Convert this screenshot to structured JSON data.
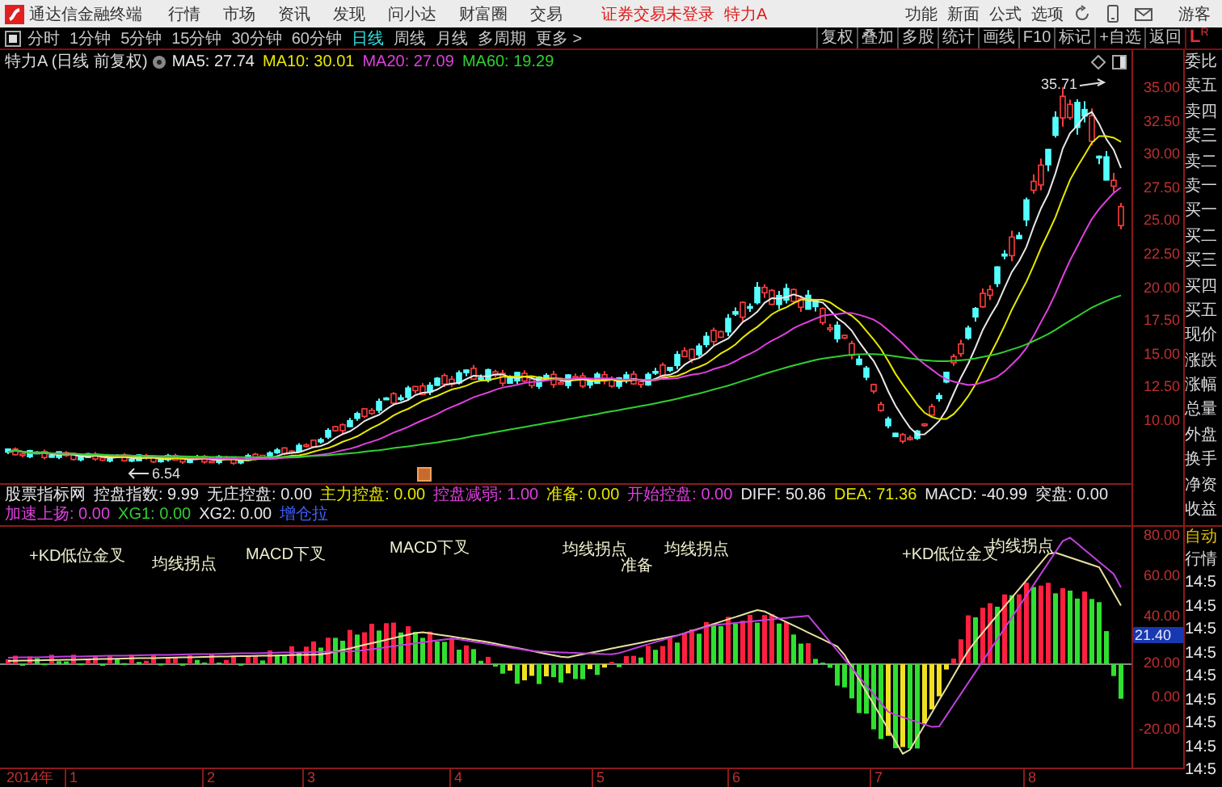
{
  "app": {
    "name": "通达信金融终端",
    "menus": [
      "行情",
      "市场",
      "资讯",
      "发现",
      "问小达",
      "财富圈",
      "交易"
    ],
    "login_notice": "证券交易未登录",
    "stock": "特力A",
    "tools": [
      "功能",
      "新面",
      "公式",
      "选项"
    ],
    "user": "游客"
  },
  "periods": [
    {
      "label": "分时",
      "selected": false
    },
    {
      "label": "1分钟",
      "selected": false
    },
    {
      "label": "5分钟",
      "selected": false
    },
    {
      "label": "15分钟",
      "selected": false
    },
    {
      "label": "30分钟",
      "selected": false
    },
    {
      "label": "60分钟",
      "selected": false
    },
    {
      "label": "日线",
      "selected": true
    },
    {
      "label": "周线",
      "selected": false
    },
    {
      "label": "月线",
      "selected": false
    },
    {
      "label": "多周期",
      "selected": false
    },
    {
      "label": "更多 >",
      "selected": false
    }
  ],
  "chart_tools": [
    "复权",
    "叠加",
    "多股",
    "统计",
    "画线",
    "F10",
    "标记",
    "+自选",
    "返回"
  ],
  "quote_logo": {
    "left": "L",
    "right": "R"
  },
  "info": {
    "title": "特力A (日线 前复权)",
    "ma": [
      {
        "label": "MA5: 27.74",
        "color": "#e8e8e8"
      },
      {
        "label": "MA10: 30.01",
        "color": "#e8e800"
      },
      {
        "label": "MA20: 27.09",
        "color": "#e040e0"
      },
      {
        "label": "MA60: 19.29",
        "color": "#30d030"
      }
    ]
  },
  "price_axis": [
    "35.00",
    "32.50",
    "30.00",
    "27.50",
    "25.00",
    "22.50",
    "20.00",
    "17.50",
    "15.00",
    "12.50",
    "10.00"
  ],
  "price_marks": {
    "high": "35.71",
    "low": "6.54"
  },
  "indicator": {
    "name": "股票指标网",
    "values": [
      {
        "label": "控盘指数: 9.99",
        "color": "#e8e8e8"
      },
      {
        "label": "无庄控盘: 0.00",
        "color": "#e8e8e8"
      },
      {
        "label": "主力控盘: 0.00",
        "color": "#e8e800"
      },
      {
        "label": "控盘减弱: 1.00",
        "color": "#e040e0"
      },
      {
        "label": "准备: 0.00",
        "color": "#e8e800"
      },
      {
        "label": "开始控盘: 0.00",
        "color": "#e040e0"
      },
      {
        "label": "DIFF: 50.86",
        "color": "#e8e8e8"
      },
      {
        "label": "DEA: 71.36",
        "color": "#e8e800"
      },
      {
        "label": "MACD: -40.99",
        "color": "#e8e8e8"
      },
      {
        "label": "突盘: 0.00",
        "color": "#e8e8e8"
      },
      {
        "label": "加速上扬: 0.00",
        "color": "#e040e0"
      },
      {
        "label": "XG1: 0.00",
        "color": "#30d030"
      },
      {
        "label": "XG2: 0.00",
        "color": "#e8e8e8"
      },
      {
        "label": "增仓拉",
        "color": "#4060ff"
      }
    ]
  },
  "indicator_axis": [
    "80.00",
    "60.00",
    "40.00",
    "20.00",
    "0.00",
    "-20.00"
  ],
  "indicator_reading": "21.40",
  "signals": [
    "+KD低位金叉",
    "均线拐点",
    "MACD下叉",
    "MACD下叉",
    "均线拐点",
    "准备",
    "均线拐点",
    "+KD低位金叉",
    "均线拐点"
  ],
  "quote_labels": [
    "委比",
    "卖五",
    "卖四",
    "卖三",
    "卖二",
    "卖一",
    "买一",
    "买二",
    "买三",
    "买四",
    "买五",
    "现价",
    "涨跌",
    "涨幅",
    "总量",
    "外盘",
    "换手",
    "净资",
    "收益"
  ],
  "lower_panel": {
    "mode": "自动",
    "title": "行情",
    "times": [
      "14:5",
      "14:5",
      "14:5",
      "14:5",
      "14:5",
      "14:5",
      "14:5",
      "14:5",
      "14:5"
    ]
  },
  "date_axis": [
    "2014年",
    "1",
    "2",
    "3",
    "4",
    "5",
    "6",
    "7",
    "8"
  ]
}
